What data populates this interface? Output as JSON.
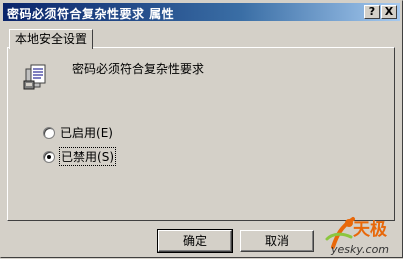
{
  "window": {
    "title": "密码必须符合复杂性要求 属性",
    "help_button": "?",
    "close_button": "X"
  },
  "tabs": [
    {
      "label": "本地安全设置",
      "active": true
    }
  ],
  "policy": {
    "icon": "policy-document-icon",
    "name": "密码必须符合复杂性要求"
  },
  "options": [
    {
      "label": "已启用",
      "accelerator": "(E)",
      "selected": false
    },
    {
      "label": "已禁用",
      "accelerator": "(S)",
      "selected": true
    }
  ],
  "buttons": {
    "ok": "确定",
    "cancel": "取消"
  },
  "watermark": {
    "brand": "天极",
    "site": "yesky.com"
  },
  "colors": {
    "title_gradient_start": "#0a246a",
    "title_gradient_end": "#a6caf0",
    "face": "#d4d0c8",
    "watermark_orange": "#e8680a"
  }
}
